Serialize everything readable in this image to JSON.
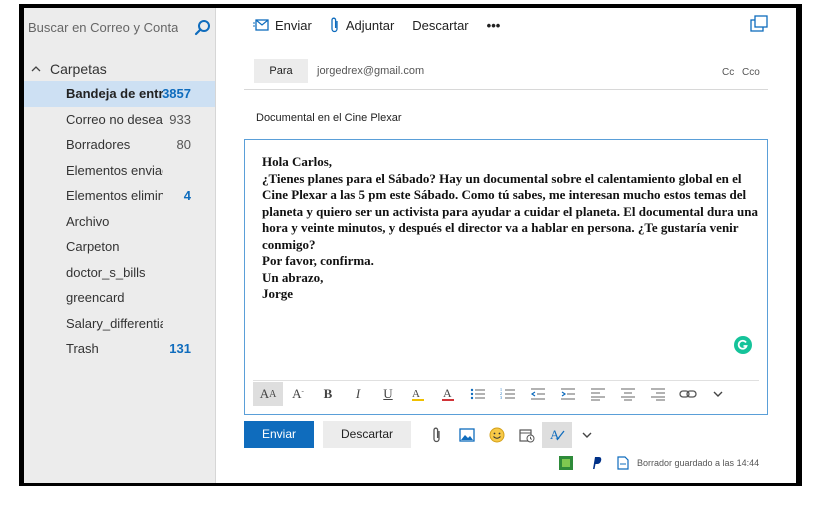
{
  "search": {
    "placeholder": "Buscar en Correo y Contactos"
  },
  "sidebar": {
    "header": "Carpetas",
    "folders": [
      {
        "label": "Bandeja de entra",
        "count": "3857"
      },
      {
        "label": "Correo no deseado",
        "count": "933"
      },
      {
        "label": "Borradores",
        "count": "80"
      },
      {
        "label": "Elementos enviados",
        "count": ""
      },
      {
        "label": "Elementos eliminados",
        "count": "4"
      },
      {
        "label": "Archivo",
        "count": ""
      },
      {
        "label": "Carpeton",
        "count": ""
      },
      {
        "label": "doctor_s_bills",
        "count": ""
      },
      {
        "label": "greencard",
        "count": ""
      },
      {
        "label": "Salary_differential",
        "count": ""
      },
      {
        "label": "Trash",
        "count": "131"
      }
    ]
  },
  "toolbar": {
    "send": "Enviar",
    "attach": "Adjuntar",
    "discard": "Descartar",
    "more": "•••"
  },
  "compose": {
    "to_label": "Para",
    "to_value": "jorgedrex@gmail.com",
    "cc": "Cc",
    "bcc": "Cco",
    "subject": "Documental en el Cine Plexar",
    "body_lines": [
      "Hola Carlos,",
      "¿Tienes planes para el Sábado? Hay un documental sobre el calentamiento global en el Cine Plexar a las 5 pm este Sábado. Como tú sabes, me interesan mucho estos temas del planeta y quiero ser un activista para ayudar a cuidar el planeta. El documental dura una hora y veinte minutos, y después el director va a hablar en persona. ¿Te gustaría venir conmigo?",
      "Por favor, confirma.",
      "Un abrazo,",
      "Jorge"
    ]
  },
  "actions": {
    "send": "Enviar",
    "discard": "Descartar"
  },
  "status": {
    "saved": "Borrador guardado a las 14:44"
  },
  "colors": {
    "accent": "#0f6cbd",
    "selected_folder": "#cde0f3",
    "sidebar_bg": "#ececec"
  }
}
